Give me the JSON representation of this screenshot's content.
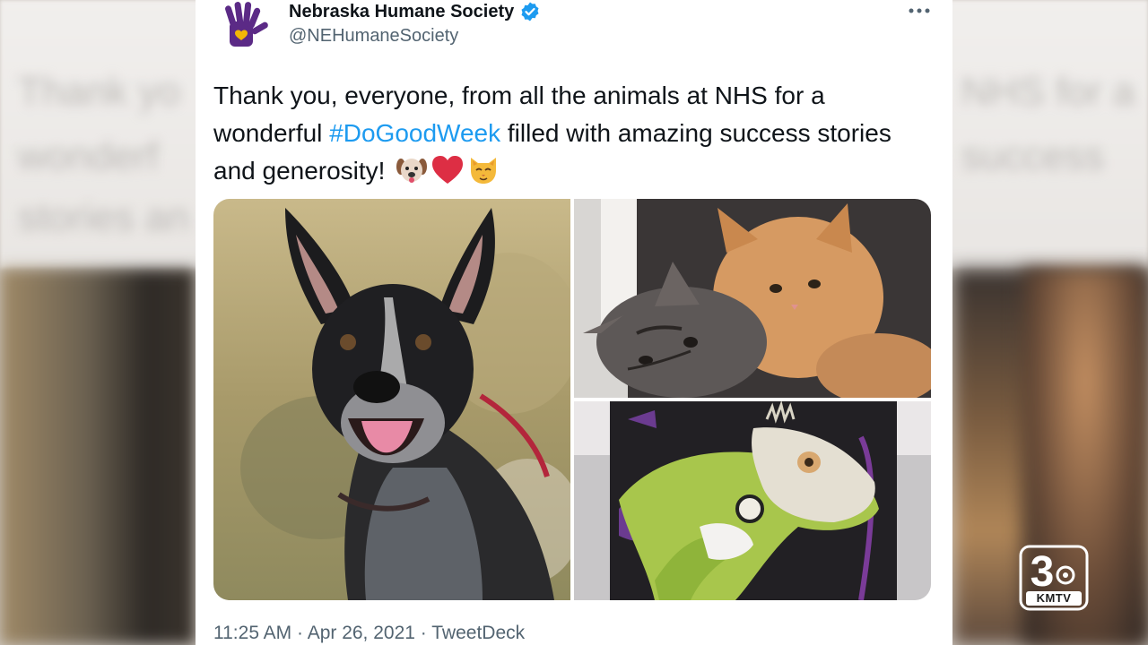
{
  "background": {
    "blurred_text_line1": "Thank yo",
    "blurred_text_line2": "wonderf",
    "blurred_text_line3": "stories an",
    "blurred_text_right1": "NHS for a",
    "blurred_text_right2": "success"
  },
  "tweet": {
    "author": {
      "name": "Nebraska Humane Society",
      "handle": "@NEHumaneSociety",
      "verified": true,
      "avatar_icon": "hand-heart-logo-icon"
    },
    "text": {
      "part1": "Thank you, everyone, from all the animals at NHS for a wonderful ",
      "hashtag": "#DoGoodWeek",
      "part2": " filled with amazing success stories and generosity! "
    },
    "emojis": [
      "dog-face-emoji",
      "red-heart-emoji",
      "cat-face-emoji"
    ],
    "media": [
      {
        "name": "dog-photo",
        "subject": "dog"
      },
      {
        "name": "kittens-photo",
        "subject": "kittens"
      },
      {
        "name": "iguana-photo",
        "subject": "iguana"
      }
    ],
    "meta": {
      "time": "11:25 AM",
      "separator1": " · ",
      "date": "Apr 26, 2021",
      "separator2": " · ",
      "source": "TweetDeck"
    }
  },
  "station": {
    "channel_number": "3",
    "call_letters": "KMTV"
  },
  "colors": {
    "hashtag": "#1d9bf0",
    "verified": "#1d9bf0",
    "brand_purple": "#5b2a86",
    "name_text": "#0f1419",
    "secondary_text": "#536471"
  }
}
